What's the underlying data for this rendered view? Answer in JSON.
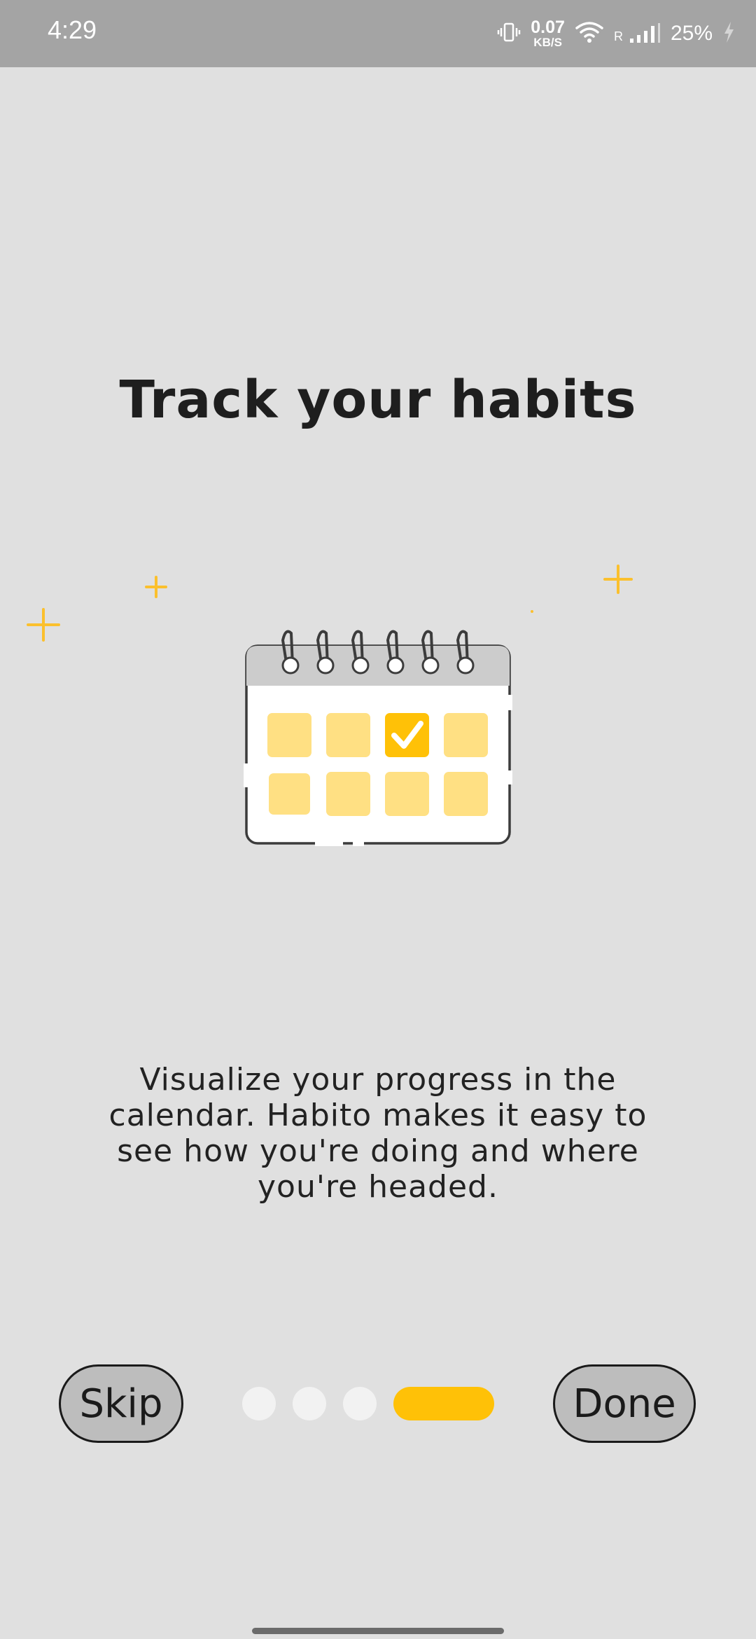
{
  "status_bar": {
    "time": "4:29",
    "net_speed_value": "0.07",
    "net_speed_unit": "KB/S",
    "roaming": "R",
    "battery": "25%"
  },
  "onboarding": {
    "title": "Track your habits",
    "description": "Visualize your progress in the calendar. Habito makes it easy to see how you're doing and where you're headed.",
    "skip_label": "Skip",
    "done_label": "Done",
    "page_count": 4,
    "current_page": 4
  },
  "colors": {
    "background": "#e0e0e0",
    "accent": "#ffc107",
    "calendar_cell": "#ffe083",
    "button_fill": "#bdbdbd"
  },
  "icons": [
    "vibrate-icon",
    "wifi-icon",
    "signal-icon",
    "battery-charging-icon",
    "calendar-illustration",
    "check-icon",
    "sparkle-icon"
  ]
}
